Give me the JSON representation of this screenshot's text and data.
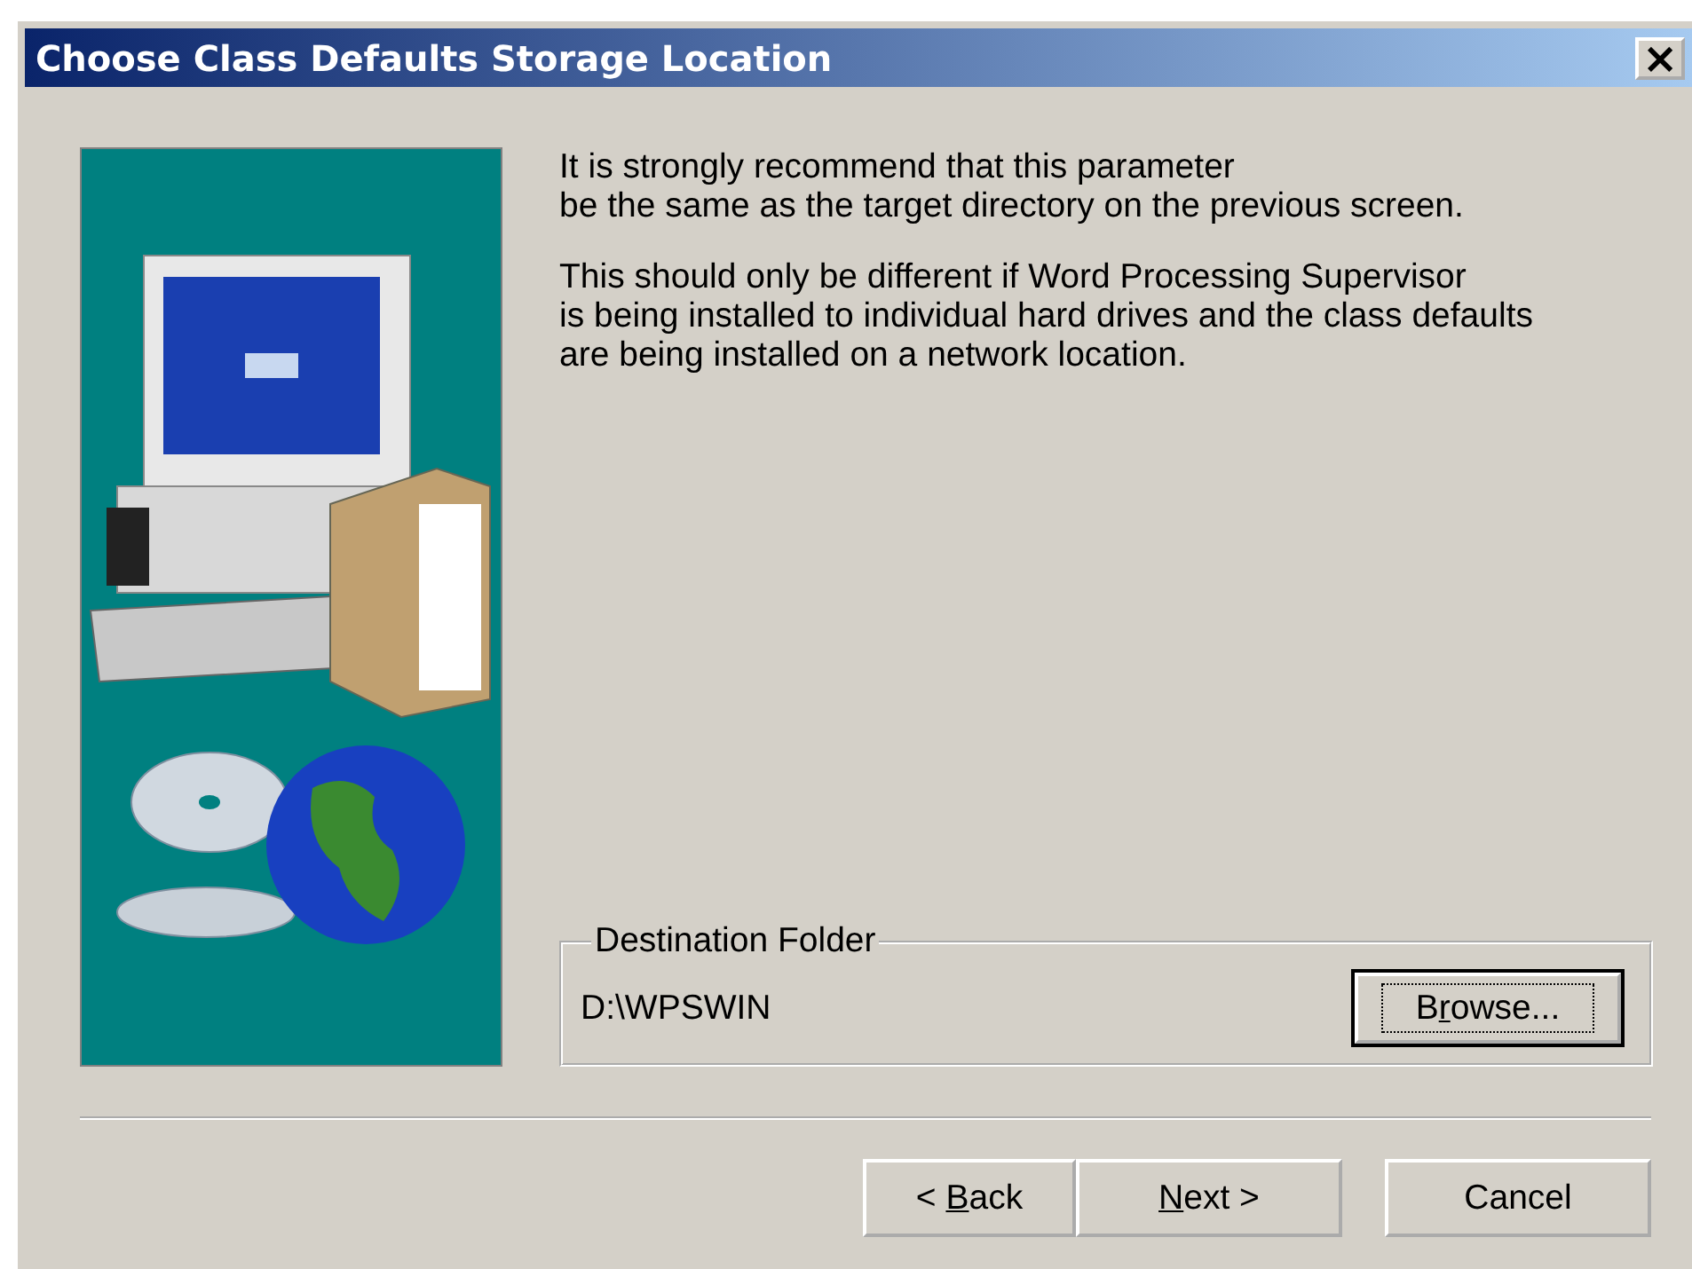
{
  "window": {
    "title": "Choose Class Defaults Storage Location",
    "close": "×"
  },
  "paragraphs": [
    "It is strongly recommend that this parameter\nbe the same as the target directory on the previous screen.",
    "This should only be different if Word Processing Supervisor\nis being installed to individual hard drives and the class defaults\nare being installed on a network location."
  ],
  "destination": {
    "legend": "Destination Folder",
    "path": "D:\\WPSWIN",
    "browse": {
      "accel": "r",
      "rest": "owse...",
      "before": "B",
      "focused": true
    }
  },
  "buttons": [
    {
      "before": "< ",
      "accel": "B",
      "rest": "ack",
      "focused": false
    },
    {
      "accel": "N",
      "rest": "ext >",
      "focused": false
    },
    {
      "before": "Cancel",
      "focused": false
    }
  ]
}
